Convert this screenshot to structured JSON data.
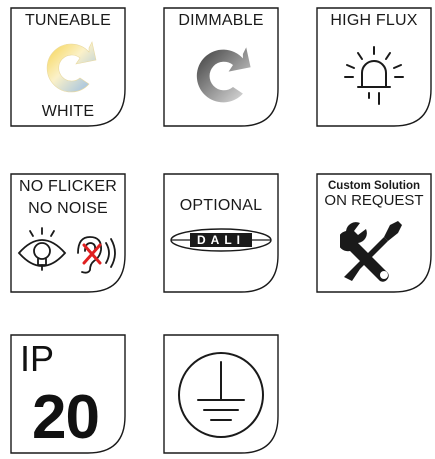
{
  "tiles": {
    "tuneable": {
      "top": "TUNEABLE",
      "bottom": "WHITE"
    },
    "dimmable": {
      "top": "DIMMABLE"
    },
    "high_flux": {
      "top": "HIGH FLUX"
    },
    "no_flicker": {
      "line1": "NO FLICKER",
      "line2": "NO NOISE"
    },
    "optional": {
      "top": "OPTIONAL",
      "badge": "DALI"
    },
    "custom": {
      "line1": "Custom Solution",
      "line2": "ON  REQUEST"
    },
    "ip": {
      "prefix": "IP",
      "rating": "20"
    },
    "earth": {}
  },
  "colors": {
    "frame": "#1a1a1a",
    "gradient_start": "#f6d24a",
    "gradient_end": "#8fb8e6",
    "gray_dark": "#3a3a3a",
    "gray_light": "#d8d8d8",
    "cross_red": "#e02020"
  },
  "icons": [
    "tuneable-white-c-icon",
    "dimmable-c-icon",
    "light-bulb-rays-icon",
    "eye-bulb-icon",
    "ear-cross-icon",
    "dali-badge-icon",
    "tools-icon",
    "earth-ground-icon"
  ]
}
